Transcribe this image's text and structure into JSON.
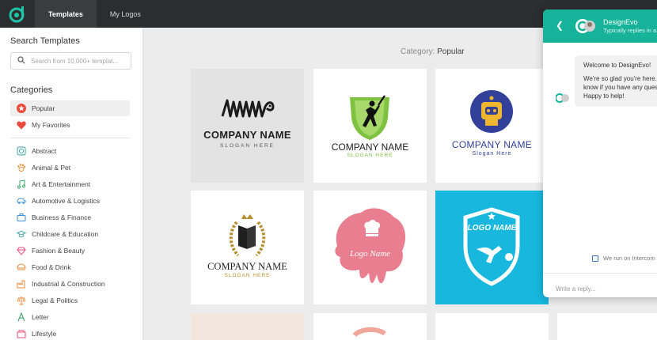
{
  "topbar": {
    "logo_icon": "designevo-logo-icon",
    "tabs": [
      {
        "label": "Templates",
        "active": true
      },
      {
        "label": "My Logos",
        "active": false
      }
    ]
  },
  "sidebar": {
    "search_title": "Search Templates",
    "search_placeholder": "Search from 10,000+ templat...",
    "categories_title": "Categories",
    "pinned": [
      {
        "label": "Popular",
        "icon": "star-icon",
        "selected": true
      },
      {
        "label": "My Favorites",
        "icon": "heart-icon",
        "selected": false
      }
    ],
    "items": [
      {
        "label": "Abstract",
        "icon": "abstract-icon"
      },
      {
        "label": "Animal & Pet",
        "icon": "paw-icon"
      },
      {
        "label": "Art & Entertainment",
        "icon": "music-note-icon"
      },
      {
        "label": "Automotive & Logistics",
        "icon": "car-icon"
      },
      {
        "label": "Business & Finance",
        "icon": "briefcase-icon"
      },
      {
        "label": "Childcare & Education",
        "icon": "graduation-cap-icon"
      },
      {
        "label": "Fashion & Beauty",
        "icon": "diamond-icon"
      },
      {
        "label": "Food & Drink",
        "icon": "food-icon"
      },
      {
        "label": "Industrial & Construction",
        "icon": "factory-icon"
      },
      {
        "label": "Legal & Politics",
        "icon": "scales-icon"
      },
      {
        "label": "Letter",
        "icon": "letter-a-icon"
      },
      {
        "label": "Lifestyle",
        "icon": "lifestyle-icon"
      }
    ]
  },
  "main": {
    "category_prefix": "Category:",
    "category_value": "Popular",
    "tiles": [
      {
        "company": "COMPANY NAME",
        "slogan": "SLOGAN HERE"
      },
      {
        "company": "COMPANY NAME",
        "slogan": "SLOGAN HERE"
      },
      {
        "company": "COMPANY NAME",
        "slogan": "Slogan Here"
      },
      {
        "company": "COMPANY NAME",
        "slogan": "SLOGAN HERE"
      },
      {
        "company": "Logo Name",
        "slogan": ""
      },
      {
        "company": "LOGO NAME",
        "slogan": ""
      }
    ]
  },
  "chat": {
    "name": "DesignEvo",
    "subtitle": "Typically replies in a",
    "messages": [
      "Welcome to DesignEvo!",
      "We're so glad you're here. Let us know if you have any questions. Happy to help!"
    ],
    "footnote": "We run on Intercom",
    "input_placeholder": "Write a reply..."
  },
  "colors": {
    "accent": "#16b29a",
    "topbar": "#2c2d2f",
    "popular_icon": "#e94b3c",
    "category_icons": "#3aa6a2"
  }
}
